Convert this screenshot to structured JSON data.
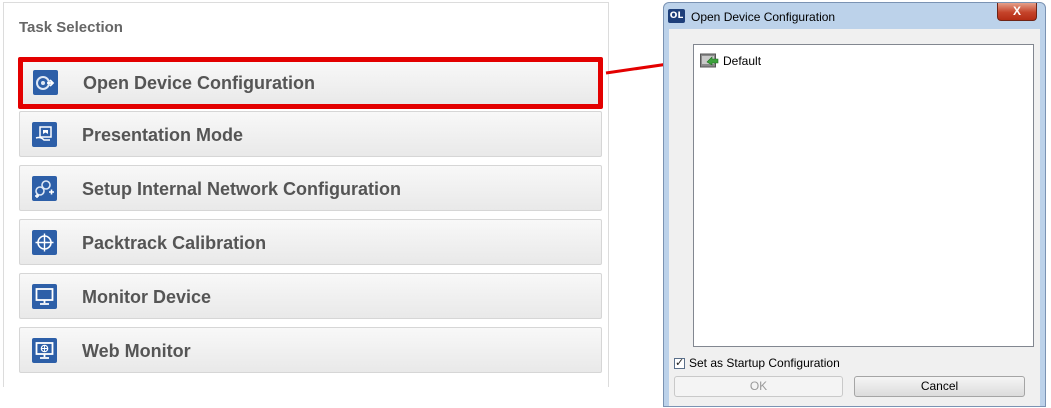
{
  "task_panel": {
    "title": "Task Selection",
    "items": [
      {
        "label": "Open Device Configuration",
        "icon": "open-config-icon",
        "selected": true
      },
      {
        "label": "Presentation Mode",
        "icon": "presentation-icon"
      },
      {
        "label": "Setup Internal Network Configuration",
        "icon": "network-setup-icon"
      },
      {
        "label": "Packtrack Calibration",
        "icon": "crosshair-icon"
      },
      {
        "label": "Monitor Device",
        "icon": "monitor-icon"
      },
      {
        "label": "Web Monitor",
        "icon": "web-monitor-icon"
      }
    ]
  },
  "colors": {
    "highlight": "#e30000",
    "icon_bg": "#2d5fa8",
    "dialog_frame": "#bcd2ea"
  },
  "dialog": {
    "app_icon_text": "OL",
    "title": "Open Device Configuration",
    "close_label": "X",
    "list": [
      {
        "label": "Default",
        "icon": "config-item-icon"
      }
    ],
    "startup_checkbox": {
      "label": "Set as Startup Configuration",
      "checked": true
    },
    "ok_label": "OK",
    "cancel_label": "Cancel"
  }
}
